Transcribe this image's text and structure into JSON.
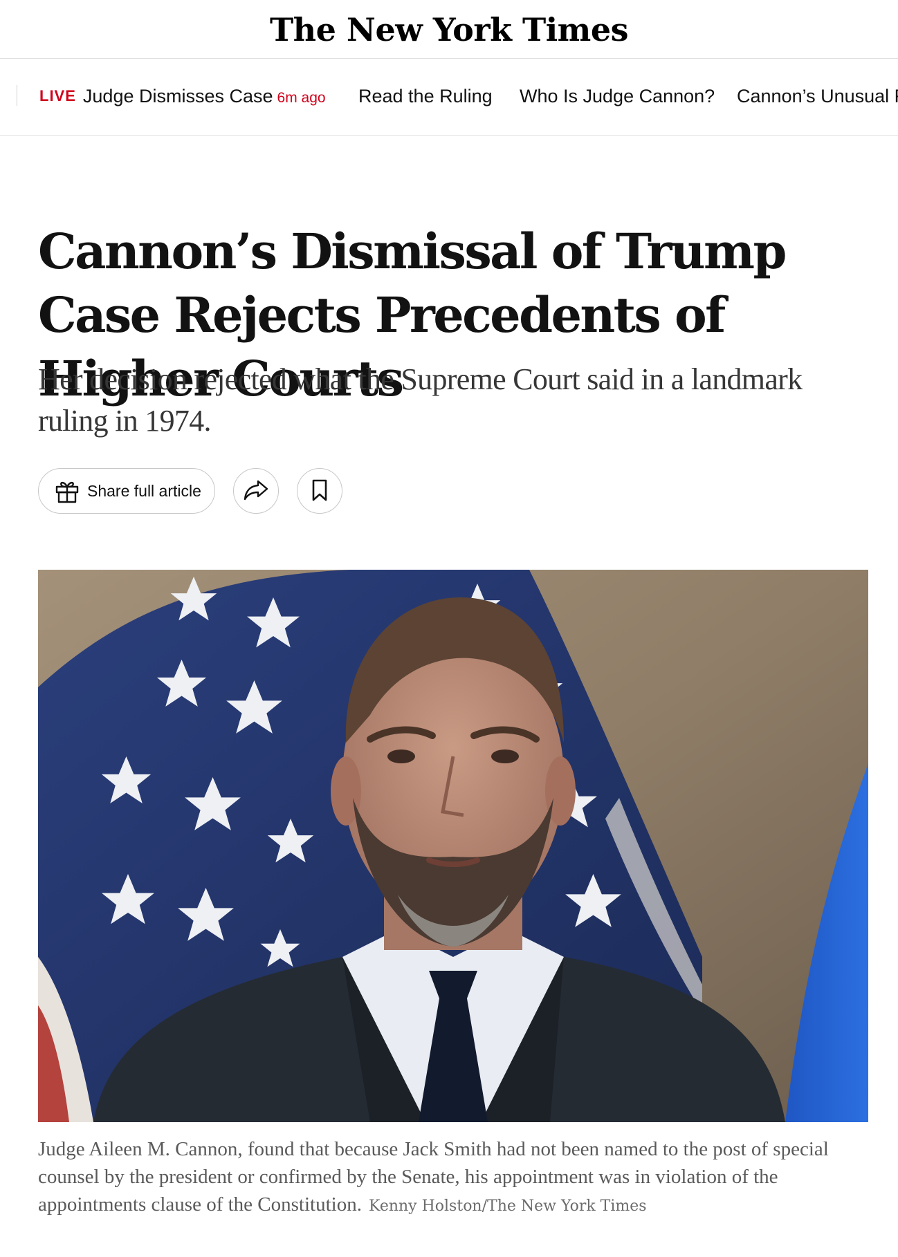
{
  "masthead": {
    "logo_text": "The New York Times"
  },
  "live_bar": {
    "live_label": "LIVE",
    "live_headline": "Judge Dismisses Case",
    "live_time": "6m ago",
    "links": [
      "Read the Ruling",
      "Who Is Judge Cannon?",
      "Cannon’s Unusual R"
    ]
  },
  "article": {
    "headline": "Cannon’s Dismissal of Trump Case Rejects Precedents of Higher Courts",
    "summary": "Her decision rejected what the Supreme Court said in a landmark ruling in 1974.",
    "share_label": "Share full article",
    "caption": "Judge Aileen M. Cannon, found that because Jack Smith had not been named to the post of special counsel by the president or confirmed by the Senate, his appointment was in violation of the appointments clause of the Constitution.",
    "credit": "Kenny Holston/The New York Times"
  },
  "icons": {
    "gift": "gift-icon",
    "share": "share-arrow-icon",
    "save": "bookmark-icon"
  },
  "colors": {
    "live_red": "#d0021b",
    "text": "#121212",
    "caption": "#5a5a5a",
    "border": "#c7c7c7"
  }
}
